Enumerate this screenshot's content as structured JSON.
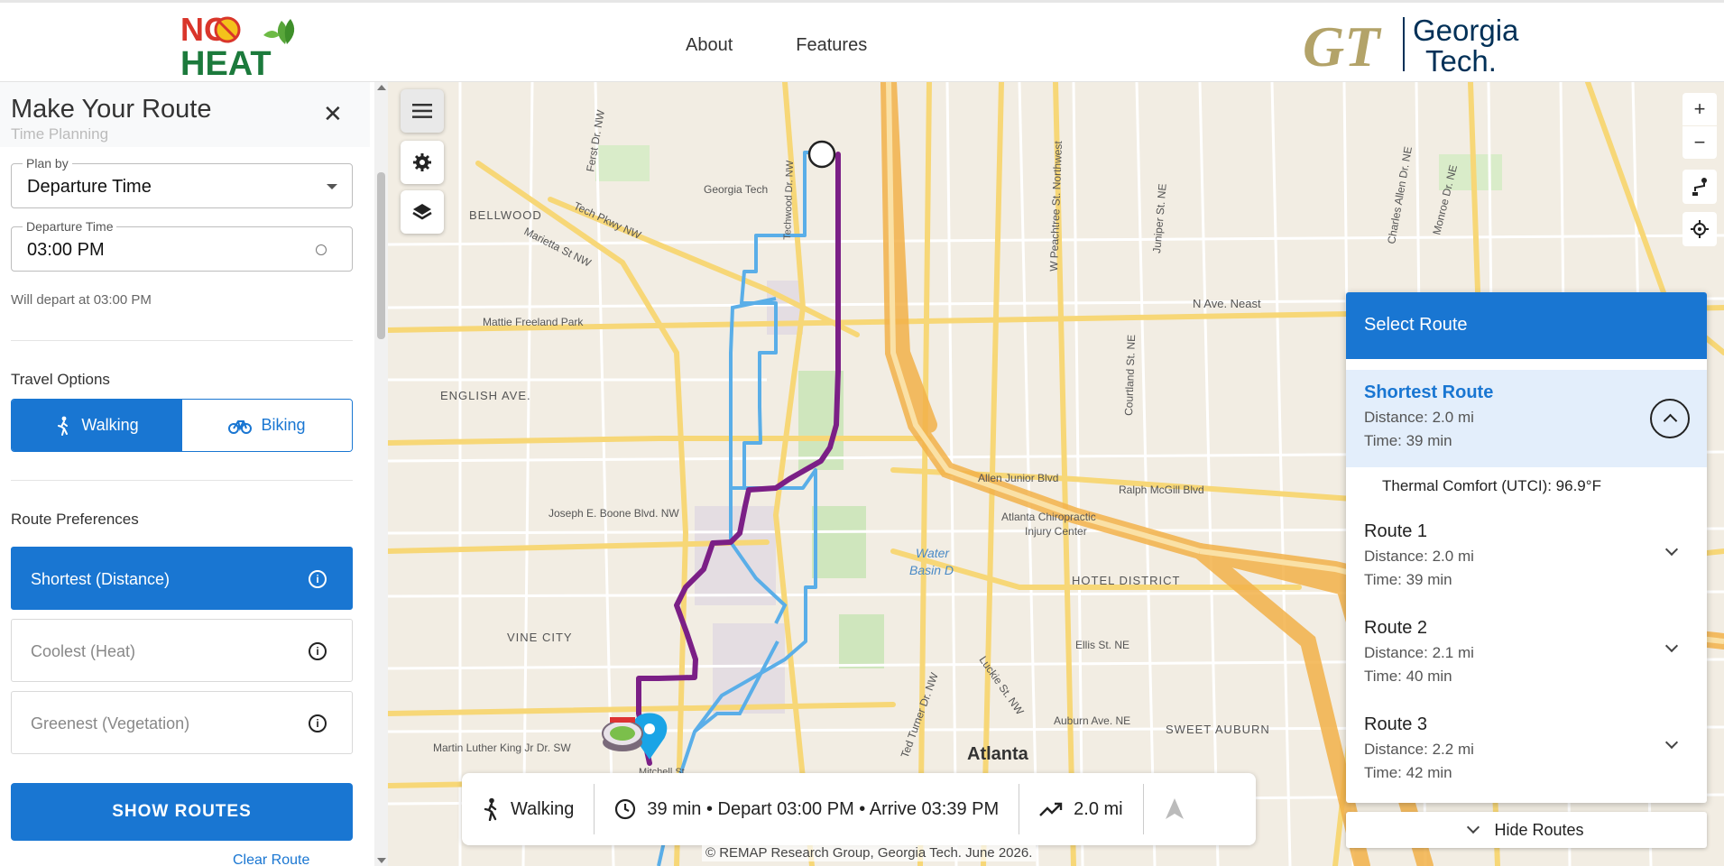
{
  "header": {
    "logo_text_line1": "NO",
    "logo_text_line2": "HEAT",
    "nav": [
      "About",
      "Features"
    ],
    "gt_logo_letters": "GT",
    "gt_name_line1": "Georgia",
    "gt_name_line2": "Tech."
  },
  "sidebar": {
    "title": "Make Your Route",
    "subtitle": "Time Planning",
    "close_label": "✕",
    "plan_by": {
      "label": "Plan by",
      "value": "Departure Time"
    },
    "departure_time": {
      "label": "Departure Time",
      "value": "03:00 PM"
    },
    "depart_note": "Will depart at 03:00 PM",
    "travel_options": {
      "label": "Travel Options",
      "walking": "Walking",
      "biking": "Biking",
      "selected": "Walking"
    },
    "route_preferences": {
      "label": "Route Preferences",
      "items": [
        "Shortest (Distance)",
        "Coolest (Heat)",
        "Greenest (Vegetation)"
      ],
      "selected": "Shortest (Distance)"
    },
    "show_routes": "SHOW ROUTES",
    "clear_route": "Clear Route"
  },
  "map": {
    "labels": {
      "georgia_tech": "Georgia Tech",
      "bellwood": "BELLWOOD",
      "mattie": "Mattie Freeland Park",
      "english_ave": "ENGLISH AVE.",
      "vine_city": "VINE CITY",
      "hotel_district": "HOTEL DISTRICT",
      "sweet_auburn": "SWEET AUBURN",
      "atlanta": "Atlanta",
      "chiropractic": "Atlanta Chiropractic",
      "injury": "Injury Center",
      "water_basin": "Water",
      "basin_d": "Basin D",
      "n_ave": "N Ave. Neast",
      "boone": "Joseph E. Boone Blvd. NW",
      "allen": "Allen Junior Blvd",
      "mcgill": "Ralph McGill Blvd",
      "mlk": "Martin Luther King Jr Dr. SW",
      "marietta": "Marietta St NW",
      "tech_pkwy": "Tech Pkwy NW",
      "ellis": "Ellis St. NE",
      "auburn": "Auburn Ave. NE",
      "first_dr": "Ferst Dr. NW",
      "peachtree": "W Peachtree St. Northwest",
      "juniper": "Juniper St. NE",
      "courtland": "Courtland St. NE",
      "charles_allen": "Charles Allen Dr. NE",
      "monroe": "Monroe Dr. NE",
      "techwood": "Techwood Dr. NW",
      "ted_turner": "Ted Turner Dr. NW",
      "luckie": "Luckie St. NW",
      "mitchell": "Mitchell St."
    },
    "colors": {
      "primary_route": "#7b1f86",
      "alt_route": "#5aaee8",
      "accent": "#1976d2"
    }
  },
  "route_panel": {
    "title": "Select Route",
    "routes": [
      {
        "name": "Shortest Route",
        "distance": "Distance: 2.0 mi",
        "time": "Time: 39 min",
        "thermal": "Thermal Comfort (UTCI): 96.9°F"
      },
      {
        "name": "Route 1",
        "distance": "Distance: 2.0 mi",
        "time": "Time: 39 min"
      },
      {
        "name": "Route 2",
        "distance": "Distance: 2.1 mi",
        "time": "Time: 40 min"
      },
      {
        "name": "Route 3",
        "distance": "Distance: 2.2 mi",
        "time": "Time: 42 min"
      }
    ],
    "hide_routes": "Hide Routes"
  },
  "info_bar": {
    "mode": "Walking",
    "timing": "39 min • Depart 03:00 PM • Arrive 03:39 PM",
    "distance": "2.0 mi"
  },
  "footer": {
    "copyright": "© REMAP Research Group, Georgia Tech. June 2026."
  }
}
